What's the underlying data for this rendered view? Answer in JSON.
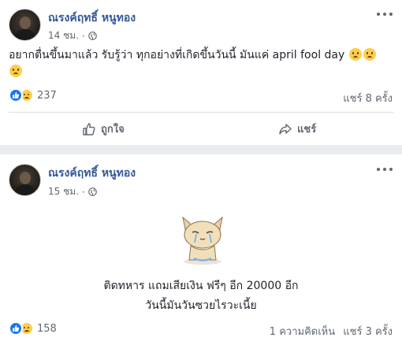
{
  "posts": [
    {
      "author": "ณรงค์ฤทธิ์ หนูทอง",
      "time": "14 ชม.",
      "dot": "·",
      "text": "อยากตื่นขึ้นมาแล้ว รับรู้ว่า ทุกอย่างที่เกิดขึ้นวันนี้ มันแค่ april fool day",
      "text_emojis": [
        "sad-but-relieved-face",
        "sad-but-relieved-face",
        "sad-but-relieved-face"
      ],
      "reaction_icons": [
        "like-icon",
        "sad-reaction-icon"
      ],
      "reaction_count": "237",
      "shares": "แชร์ 8 ครั้ง",
      "actions": {
        "like": "ถูกใจ",
        "share": "แชร์"
      }
    },
    {
      "author": "ณรงค์ฤทธิ์ หนูทอง",
      "time": "15 ชม.",
      "dot": "·",
      "sticker": "crying-cat-sticker",
      "caption_line1": "ติดทหาร แถมเสียเงิน ฟรีๆ อีก 20000 อีก",
      "caption_line2": "วันนี้มันวันซวยไรวะเนี้ย",
      "reaction_icons": [
        "like-icon",
        "sad-reaction-icon"
      ],
      "reaction_count": "158",
      "comments": "1 ความคิดเห็น",
      "shares": "แชร์ 3 ครั้ง"
    }
  ],
  "colors": {
    "link": "#365899",
    "like_blue": "#1877f2",
    "muted": "#606770",
    "background": "#e9ebee"
  }
}
